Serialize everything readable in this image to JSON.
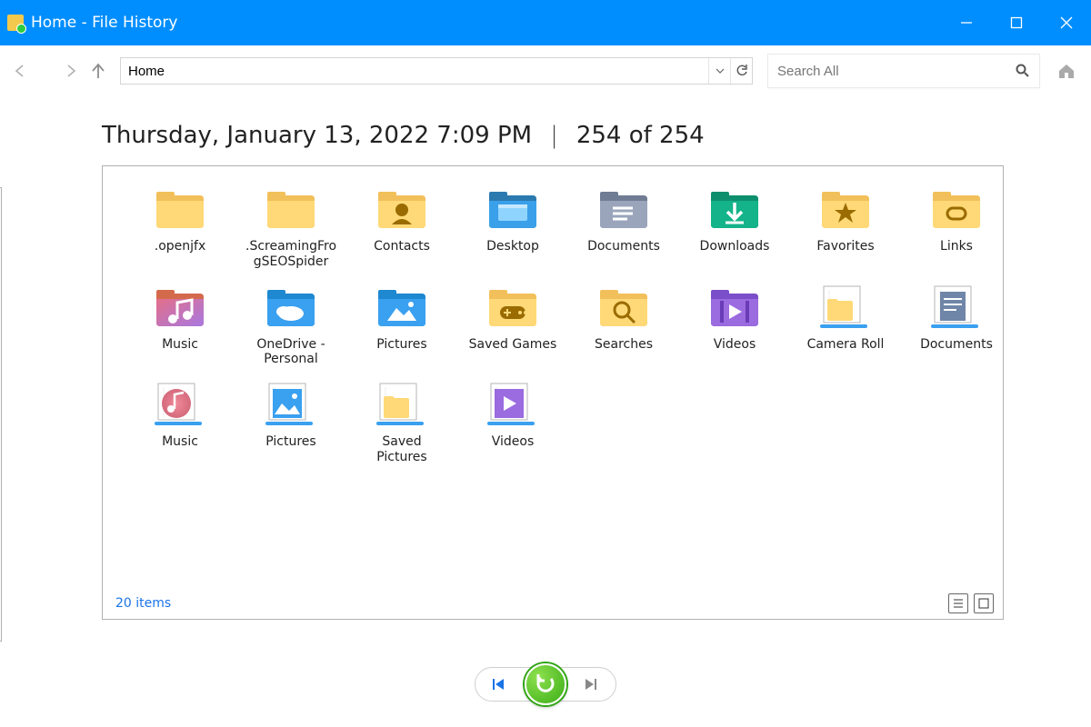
{
  "window": {
    "title": "Home - File History"
  },
  "nav": {
    "address": "Home",
    "search_placeholder": "Search All"
  },
  "heading": {
    "date": "Thursday, January 13, 2022 7:09 PM",
    "separator": "|",
    "count": "254 of 254"
  },
  "footer": {
    "item_count": "20 items"
  },
  "items": [
    {
      "label": ".openjfx",
      "icon": "folder"
    },
    {
      "label": ".ScreamingFrogSEOSpider",
      "icon": "folder"
    },
    {
      "label": "Contacts",
      "icon": "folder-contacts"
    },
    {
      "label": "Desktop",
      "icon": "folder-desktop"
    },
    {
      "label": "Documents",
      "icon": "folder-documents"
    },
    {
      "label": "Downloads",
      "icon": "folder-downloads"
    },
    {
      "label": "Favorites",
      "icon": "folder-favorites"
    },
    {
      "label": "Links",
      "icon": "folder-links"
    },
    {
      "label": "Music",
      "icon": "folder-music"
    },
    {
      "label": "OneDrive - Personal",
      "icon": "folder-onedrive"
    },
    {
      "label": "Pictures",
      "icon": "folder-pictures"
    },
    {
      "label": "Saved Games",
      "icon": "folder-games"
    },
    {
      "label": "Searches",
      "icon": "folder-search"
    },
    {
      "label": "Videos",
      "icon": "folder-videos"
    },
    {
      "label": "Camera Roll",
      "icon": "library-camera"
    },
    {
      "label": "Documents",
      "icon": "library-documents"
    },
    {
      "label": "Music",
      "icon": "library-music"
    },
    {
      "label": "Pictures",
      "icon": "library-pictures"
    },
    {
      "label": "Saved Pictures",
      "icon": "library-saved-pictures"
    },
    {
      "label": "Videos",
      "icon": "library-videos"
    }
  ],
  "colors": {
    "titlebar_bg": "#008eff",
    "accent_blue": "#1a73e8",
    "restore_green": "#3aae16",
    "folder_yellow": "#f9d36a"
  }
}
